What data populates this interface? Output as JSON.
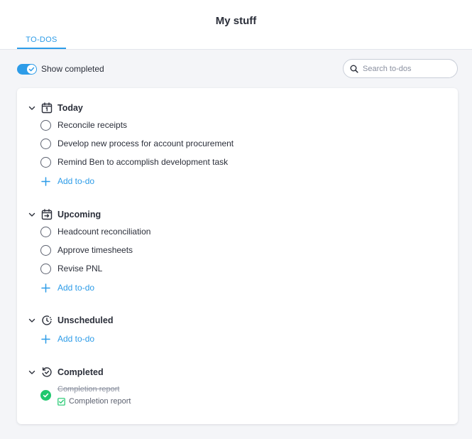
{
  "header": {
    "title": "My stuff",
    "tabs": [
      {
        "label": "TO-DOS",
        "active": true
      }
    ]
  },
  "toolbar": {
    "show_completed_label": "Show completed",
    "show_completed": true,
    "search_placeholder": "Search to-dos"
  },
  "colors": {
    "accent": "#2d9ce8",
    "success": "#1fc86e",
    "background": "#f4f5f8"
  },
  "sections": {
    "today": {
      "title": "Today",
      "icon": "calendar-day-icon",
      "items": [
        "Reconcile receipts",
        "Develop new process for account procurement",
        "Remind Ben to accomplish development task"
      ],
      "add_label": "Add to-do"
    },
    "upcoming": {
      "title": "Upcoming",
      "icon": "calendar-arrow-icon",
      "items": [
        "Headcount reconciliation",
        "Approve timesheets",
        "Revise PNL"
      ],
      "add_label": "Add to-do"
    },
    "unscheduled": {
      "title": "Unscheduled",
      "icon": "clock-pending-icon",
      "items": [],
      "add_label": "Add to-do"
    },
    "completed": {
      "title": "Completed",
      "icon": "history-icon",
      "items": [
        {
          "label": "Completion report",
          "meta": "Completion report"
        }
      ]
    }
  }
}
